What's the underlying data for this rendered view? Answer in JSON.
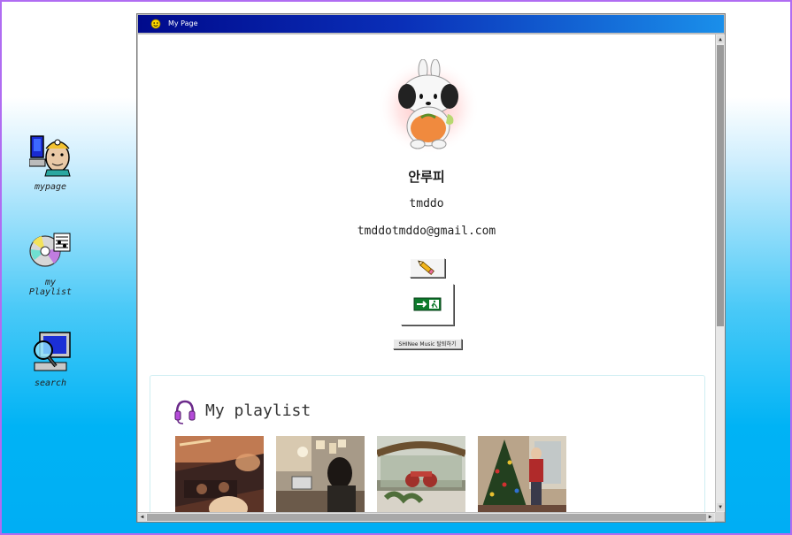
{
  "desktop": {
    "icons": [
      {
        "label": "mypage",
        "icon": "mypage-icon"
      },
      {
        "label": "my\nPlaylist",
        "icon": "cd-music-icon"
      },
      {
        "label": "search",
        "icon": "computer-search-icon"
      }
    ]
  },
  "window": {
    "title": "My Page",
    "title_icon": "smiley-icon"
  },
  "profile": {
    "image_icon": "bunny-dog-character-icon",
    "nickname": "안루피",
    "user_id": "tmddo",
    "email": "tmddotmddo@gmail.com",
    "edit_icon": "pencil-icon",
    "logout_icon": "exit-sign-icon",
    "withdraw_label": "SHINee Music 탈퇴하기"
  },
  "playlist": {
    "title": "My playlist",
    "icon": "headphones-icon",
    "items": [
      {
        "name": "dj-party-thumbnail"
      },
      {
        "name": "study-room-thumbnail"
      },
      {
        "name": "cafe-window-thumbnail"
      },
      {
        "name": "christmas-tree-thumbnail"
      }
    ]
  },
  "colors": {
    "desktop_border": "#b06cf2",
    "titlebar_start": "#000a8c",
    "titlebar_end": "#1a8fea",
    "desktop_bottom": "#00aef4"
  }
}
